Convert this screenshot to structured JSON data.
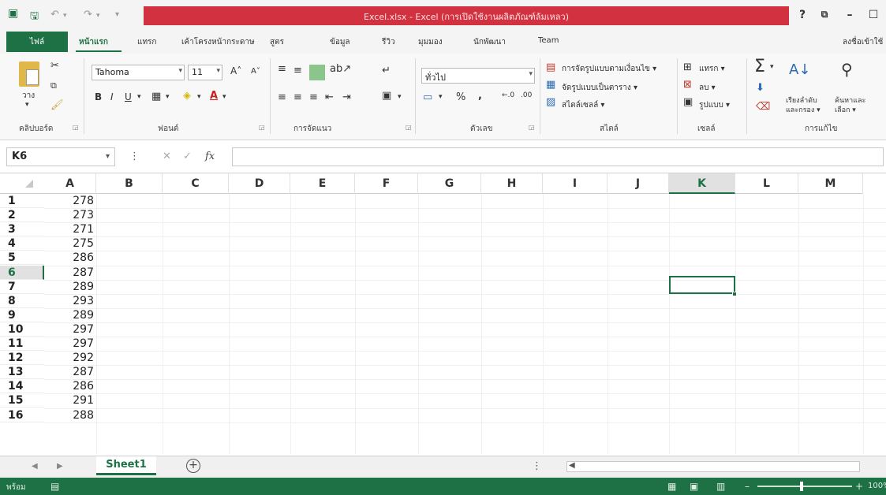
{
  "titlebar": {
    "title": "Excel.xlsx - Excel (การเปิดใช้งานผลิตภัณฑ์ล้มเหลว)",
    "help": "?",
    "restore": "⧉",
    "minimize": "–",
    "maximize": "☐"
  },
  "ribbon_tabs": {
    "file": "ไฟล์",
    "home": "หน้าแรก",
    "insert": "แทรก",
    "page_layout": "เค้าโครงหน้ากระดาษ",
    "formulas": "สูตร",
    "data": "ข้อมูล",
    "review": "รีวิว",
    "view": "มุมมอง",
    "developer": "นักพัฒนา",
    "team": "Team",
    "sign_in": "ลงชื่อเข้าใช้"
  },
  "clipboard": {
    "paste": "วาง",
    "label": "คลิปบอร์ด"
  },
  "font": {
    "name": "Tahoma",
    "size": "11",
    "bold": "B",
    "italic": "I",
    "underline": "U",
    "label": "ฟอนต์"
  },
  "alignment": {
    "label": "การจัดแนว"
  },
  "number": {
    "format": "ทั่วไป",
    "percent": "%",
    "comma": ",",
    "inc_decimal": "←.0",
    "dec_decimal": ".00",
    "label": "ตัวเลข"
  },
  "styles": {
    "conditional": "การจัดรูปแบบตามเงื่อนไข ▾",
    "as_table": "จัดรูปแบบเป็นตาราง ▾",
    "cell_styles": "สไตล์เซลล์ ▾",
    "label": "สไตล์"
  },
  "cells": {
    "insert": "แทรก ▾",
    "delete": "ลบ ▾",
    "format": "รูปแบบ ▾",
    "label": "เซลล์"
  },
  "editing": {
    "sort_filter_1": "เรียงลำดับ",
    "sort_filter_2": "และกรอง ▾",
    "find_select_1": "ค้นหาและ",
    "find_select_2": "เลือก ▾",
    "label": "การแก้ไข"
  },
  "formula_bar": {
    "name_box": "K6",
    "cancel": "✕",
    "enter": "✓",
    "fx": "fx",
    "content": ""
  },
  "sheet": {
    "columns": [
      "A",
      "B",
      "C",
      "D",
      "E",
      "F",
      "G",
      "H",
      "I",
      "J",
      "K",
      "L",
      "M"
    ],
    "selected_column": "K",
    "rows": [
      {
        "n": "1",
        "a": "278"
      },
      {
        "n": "2",
        "a": "273"
      },
      {
        "n": "3",
        "a": "271"
      },
      {
        "n": "4",
        "a": "275"
      },
      {
        "n": "5",
        "a": "286"
      },
      {
        "n": "6",
        "a": "287"
      },
      {
        "n": "7",
        "a": "289"
      },
      {
        "n": "8",
        "a": "293"
      },
      {
        "n": "9",
        "a": "289"
      },
      {
        "n": "10",
        "a": "297"
      },
      {
        "n": "11",
        "a": "297"
      },
      {
        "n": "12",
        "a": "292"
      },
      {
        "n": "13",
        "a": "287"
      },
      {
        "n": "14",
        "a": "286"
      },
      {
        "n": "15",
        "a": "291"
      },
      {
        "n": "16",
        "a": "288"
      }
    ],
    "selected_row": "6",
    "active_cell": "K6"
  },
  "sheet_tabs": {
    "active": "Sheet1",
    "add": "+"
  },
  "status": {
    "text": "พร้อม",
    "zoom": "100%"
  },
  "colors": {
    "excel_green": "#1e7145",
    "title_red": "#d2323f"
  }
}
